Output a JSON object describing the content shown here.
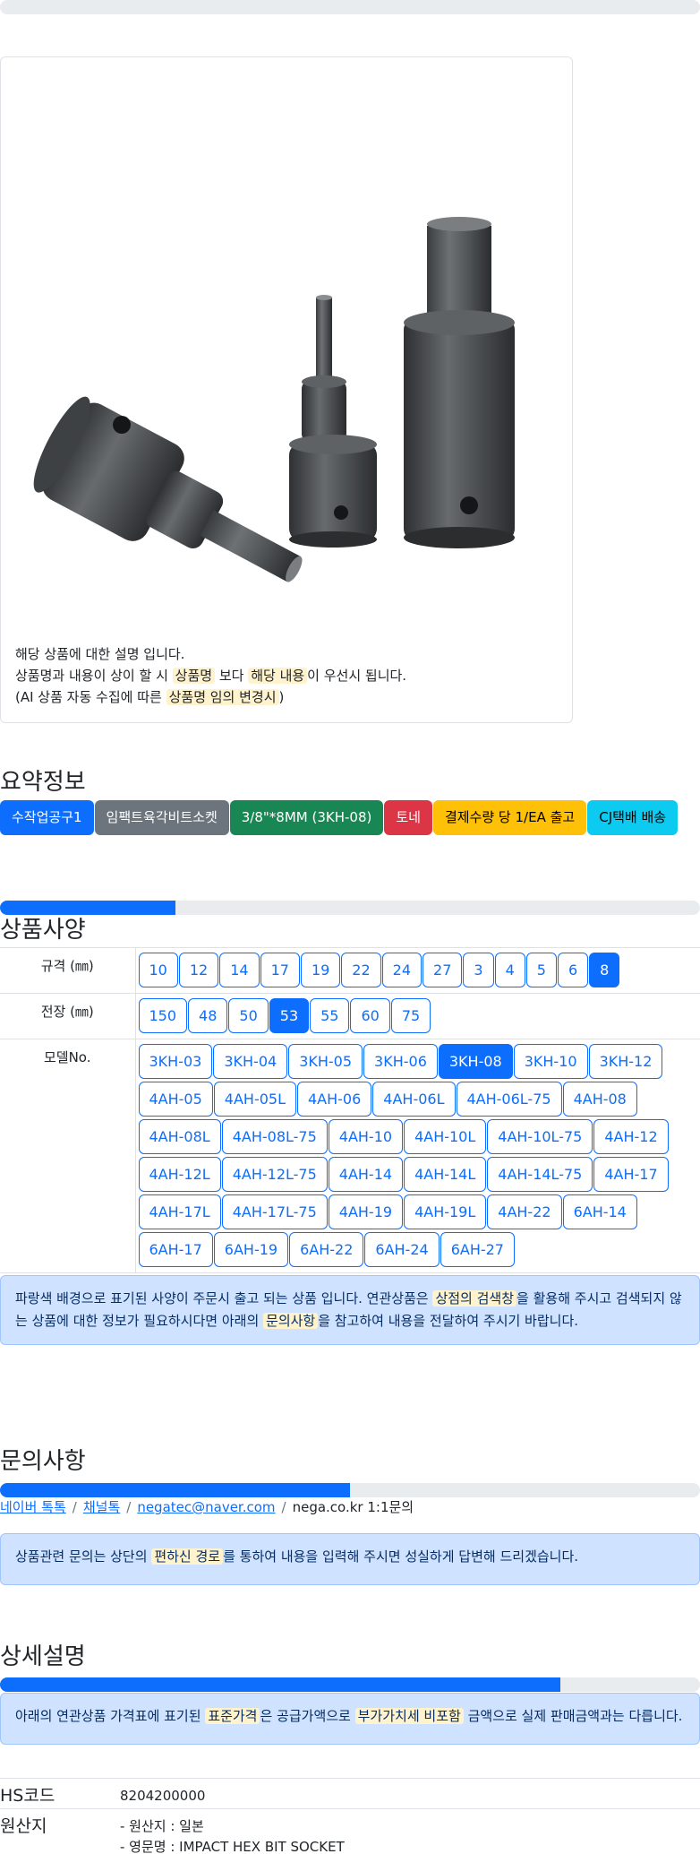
{
  "notice": {
    "line1": "해당 상품에 대한 설명 입니다.",
    "line2_a": "상품명과 내용이 상이 할 시 ",
    "line2_hl1": "상품명",
    "line2_b": " 보다 ",
    "line2_hl2": "해당 내용",
    "line2_c": "이 우선시 됩니다.",
    "line3_a": "(AI 상품 자동 수집에 따른 ",
    "line3_hl": "상품명 임의 변경시",
    "line3_b": ")"
  },
  "summary": {
    "title": "요약정보",
    "badges": [
      {
        "label": "수작업공구1",
        "color": "#0d6efd"
      },
      {
        "label": "임팩트육각비트소켓",
        "color": "#6c757d"
      },
      {
        "label": "3/8\"*8MM (3KH-08)",
        "color": "#198754"
      },
      {
        "label": "토네",
        "color": "#dc3545"
      },
      {
        "label": "결제수량 당 1/EA 출고",
        "color": "#ffc107"
      },
      {
        "label": "CJ택배 배송",
        "color": "#0dcaf0"
      }
    ],
    "progress": 0.25
  },
  "spec": {
    "title": "상품사양",
    "rows": [
      {
        "label": "규격 (㎜)",
        "options": [
          "10",
          "12",
          "14",
          "17",
          "19",
          "22",
          "24",
          "27",
          "3",
          "4",
          "5",
          "6",
          "8"
        ],
        "selected": "8"
      },
      {
        "label": "전장 (㎜)",
        "options": [
          "150",
          "48",
          "50",
          "53",
          "55",
          "60",
          "75"
        ],
        "selected": "53"
      },
      {
        "label": "모델No.",
        "options": [
          "3KH-03",
          "3KH-04",
          "3KH-05",
          "3KH-06",
          "3KH-08",
          "3KH-10",
          "3KH-12",
          "4AH-05",
          "4AH-05L",
          "4AH-06",
          "4AH-06L",
          "4AH-06L-75",
          "4AH-08",
          "4AH-08L",
          "4AH-08L-75",
          "4AH-10",
          "4AH-10L",
          "4AH-10L-75",
          "4AH-12",
          "4AH-12L",
          "4AH-12L-75",
          "4AH-14",
          "4AH-14L",
          "4AH-14L-75",
          "4AH-17",
          "4AH-17L",
          "4AH-17L-75",
          "4AH-19",
          "4AH-19L",
          "4AH-22",
          "6AH-14",
          "6AH-17",
          "6AH-19",
          "6AH-22",
          "6AH-24",
          "6AH-27"
        ],
        "selected": "3KH-08"
      }
    ],
    "alert_a": "파랑색 배경으로 표기된 사양이 주문시 출고 되는 상품 입니다. 연관상품은 ",
    "alert_hl1": "상점의 검색창",
    "alert_b": "을 활용해 주시고 검색되지 않는 상품에 대한 정보가 필요하시다면 아래의 ",
    "alert_hl2": "문의사항",
    "alert_c": "을 참고하여 내용을 전달하여 주시기 바랍니다."
  },
  "inquiry": {
    "title": "문의사항",
    "progress": 0.5,
    "links": [
      "네이버 톡톡",
      "채널톡",
      "negatec@naver.com"
    ],
    "tail": "nega.co.kr 1:1문의",
    "alert_a": "상품관련 문의는 상단의 ",
    "alert_hl": "편하신 경로",
    "alert_b": "를 통하여 내용을 입력해 주시면 성실하게 답변해 드리겠습니다."
  },
  "detail": {
    "title": "상세설명",
    "progress": 0.8,
    "alert_a": "아래의 연관상품 가격표에 표기된 ",
    "alert_hl1": "표준가격",
    "alert_b": "은 공급가액으로 ",
    "alert_hl2": "부가가치세 비포함",
    "alert_c": " 금액으로 실제 판매금액과는 다릅니다.",
    "hs_label": "HS코드",
    "hs_value": "8204200000",
    "origin_label": "원산지",
    "origin_line1": "- 원산지 : 일본",
    "origin_line2": "- 영문명 : IMPACT HEX BIT SOCKET"
  }
}
